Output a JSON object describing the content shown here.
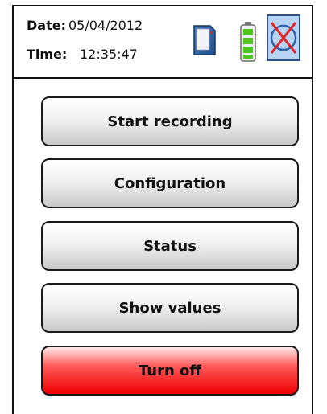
{
  "header": {
    "date_label": "Date:",
    "date_value": "05/04/2012",
    "time_label": "Time:",
    "time_value": "12:35:47",
    "icons": [
      "sd-card-icon",
      "battery-icon",
      "network-disconnected-icon"
    ]
  },
  "menu": {
    "start_recording": "Start recording",
    "configuration": "Configuration",
    "status": "Status",
    "show_values": "Show values",
    "turn_off": "Turn off"
  },
  "colors": {
    "button_gray": "#d4d4d4",
    "turn_off_red": "#ee0000",
    "battery_green": "#4cc81a",
    "network_box": "#9cc6ee",
    "network_cross": "#e32222"
  }
}
